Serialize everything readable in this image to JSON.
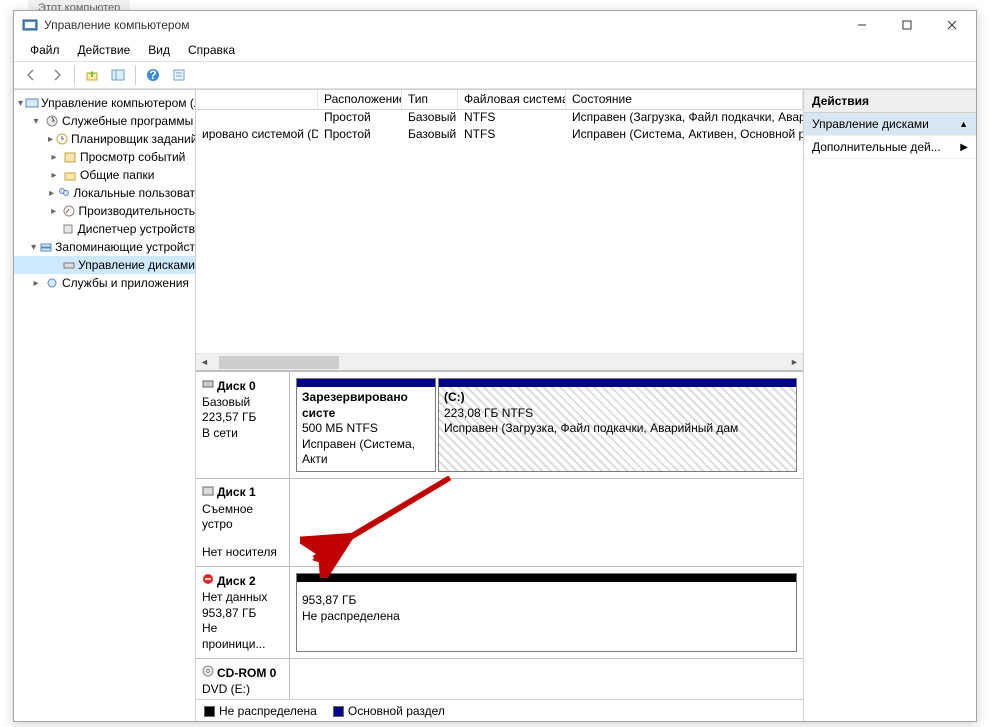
{
  "bg": {
    "explorer_tab": "Этот компьютер"
  },
  "window": {
    "title": "Управление компьютером"
  },
  "menu": {
    "file": "Файл",
    "action": "Действие",
    "view": "Вид",
    "help": "Справка"
  },
  "tree": {
    "root": "Управление компьютером (л",
    "tools": "Служебные программы",
    "scheduler": "Планировщик заданий",
    "eventvwr": "Просмотр событий",
    "shared": "Общие папки",
    "localusers": "Локальные пользоват",
    "perf": "Производительность",
    "devmgr": "Диспетчер устройств",
    "storage": "Запоминающие устройст",
    "diskmgmt": "Управление дисками",
    "services": "Службы и приложения"
  },
  "volcols": {
    "vol": "",
    "layout": "Расположение",
    "type": "Тип",
    "fs": "Файловая система",
    "status": "Состояние"
  },
  "volumes": [
    {
      "name": "",
      "layout": "Простой",
      "type": "Базовый",
      "fs": "NTFS",
      "status": "Исправен (Загрузка, Файл подкачки, Авари"
    },
    {
      "name": "ировано системой (D:)",
      "layout": "Простой",
      "type": "Базовый",
      "fs": "NTFS",
      "status": "Исправен (Система, Активен, Основной ра"
    }
  ],
  "disks": {
    "d0": {
      "name": "Диск 0",
      "type": "Базовый",
      "size": "223,57 ГБ",
      "state": "В сети",
      "p0": {
        "name": "Зарезервировано систе",
        "line2": "500 МБ NTFS",
        "line3": "Исправен (Система, Акти"
      },
      "p1": {
        "name": "(C:)",
        "line2": "223,08 ГБ NTFS",
        "line3": "Исправен (Загрузка, Файл подкачки, Аварийный дам"
      }
    },
    "d1": {
      "name": "Диск 1",
      "type": "Съемное устро",
      "nomedia": "Нет носителя"
    },
    "d2": {
      "name": "Диск 2",
      "type": "Нет данных",
      "size": "953,87 ГБ",
      "state": "Не проиници...",
      "p0": {
        "line2": "953,87 ГБ",
        "line3": "Не распределена"
      }
    },
    "cd": {
      "name": "CD-ROM 0",
      "type": "DVD (E:)"
    }
  },
  "legend": {
    "unalloc": "Не распределена",
    "primary": "Основной раздел"
  },
  "actions": {
    "hdr": "Действия",
    "diskmgmt": "Управление дисками",
    "more": "Дополнительные дей..."
  }
}
